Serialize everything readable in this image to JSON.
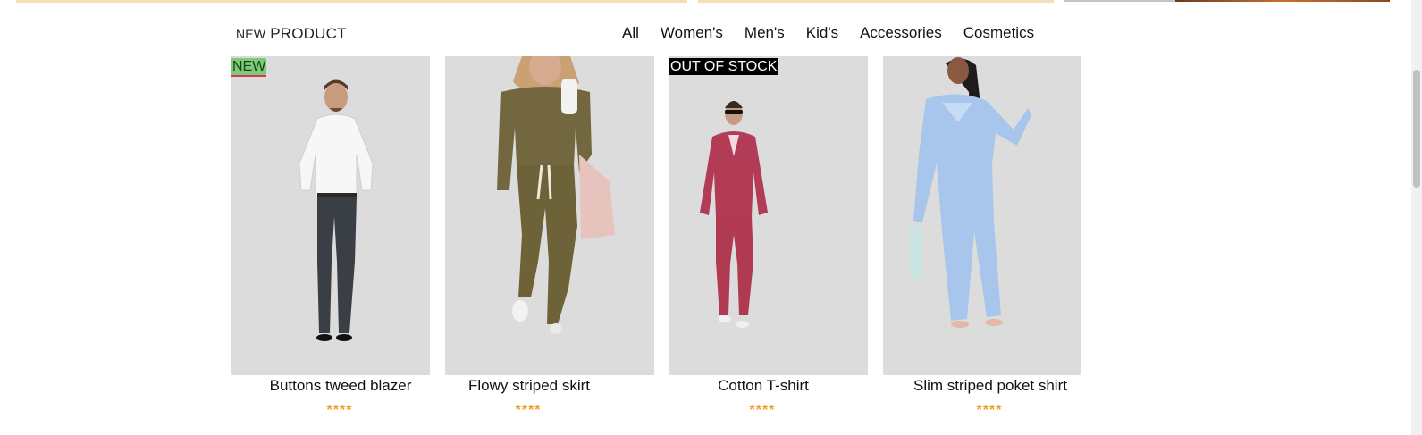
{
  "section": {
    "prefix": "NEW",
    "title": "PRODUCT"
  },
  "filters": [
    "All",
    "Women's",
    "Men's",
    "Kid's",
    "Accessories",
    "Cosmetics"
  ],
  "products": [
    {
      "name": "Buttons tweed blazer",
      "badge": "NEW",
      "rating_text": "****",
      "rating": 4
    },
    {
      "name": "Flowy striped skirt",
      "badge": "",
      "rating_text": "****",
      "rating": 4
    },
    {
      "name": "Cotton T-shirt",
      "badge": "OUT OF STOCK",
      "rating_text": "****",
      "rating": 4
    },
    {
      "name": "Slim striped poket shirt",
      "badge": "",
      "rating_text": "****",
      "rating": 4
    }
  ],
  "colors": {
    "card_background": "#dcdcdc",
    "badge_new": "#7ccb79",
    "badge_out_of_stock": "#000000",
    "rating": "#f0a02c"
  }
}
